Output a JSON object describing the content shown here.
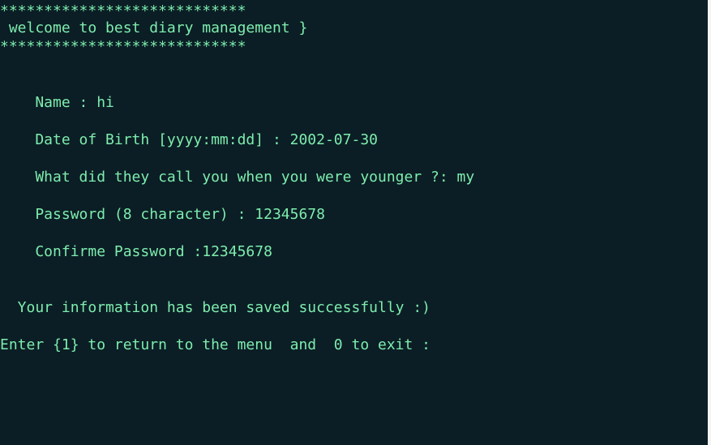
{
  "terminal": {
    "border_top": "****************************",
    "welcome": " welcome to best diary management }",
    "border_bottom": "****************************",
    "name_line": "    Name : hi",
    "dob_line": "    Date of Birth [yyyy:mm:dd] : 2002-07-30",
    "nickname_line": "    What did they call you when you were younger ?: my",
    "password_line": "    Password (8 character) : 12345678",
    "confirm_line": "    Confirme Password :12345678",
    "success_line": "  Your information has been saved successfully :)",
    "prompt_line": "Enter {1} to return to the menu  and  0 to exit :"
  },
  "colors": {
    "background": "#0b1e25",
    "text": "#7eedae"
  }
}
